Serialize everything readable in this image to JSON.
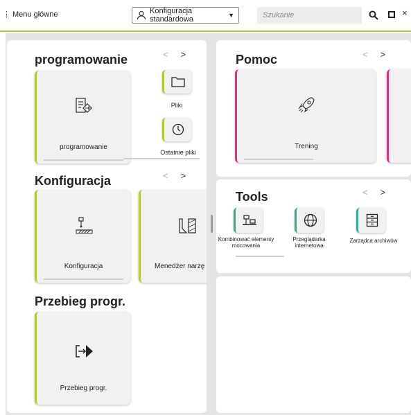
{
  "header": {
    "menu_label": "Menu główne",
    "config_label": "Konfiguracja standardowa",
    "search_placeholder": "Szukanie"
  },
  "nav": {
    "prev": "<",
    "next": ">"
  },
  "programming": {
    "title": "programowanie",
    "main_card": "programowanie",
    "files": "Pliki",
    "recent": "Ostatnie pliki"
  },
  "configuration": {
    "title": "Konfiguracja",
    "card1": "Konfiguracja",
    "card2": "Menedżer narzę"
  },
  "program_run": {
    "title": "Przebieg progr.",
    "card": "Przebieg progr."
  },
  "help": {
    "title": "Pomoc",
    "card": "Trening"
  },
  "tools": {
    "title": "Tools",
    "items": [
      {
        "label": "Kombinować elementy mocowania",
        "icon": "fixture-icon"
      },
      {
        "label": "Przeglądarka internetowa",
        "icon": "globe-icon"
      },
      {
        "label": "Zarządca archiwów",
        "icon": "archive-icon"
      }
    ]
  },
  "colors": {
    "accent_green": "#b5c63b",
    "accent_magenta": "#d6338a",
    "accent_teal": "#3aa88f",
    "background": "#e4e4e4"
  }
}
